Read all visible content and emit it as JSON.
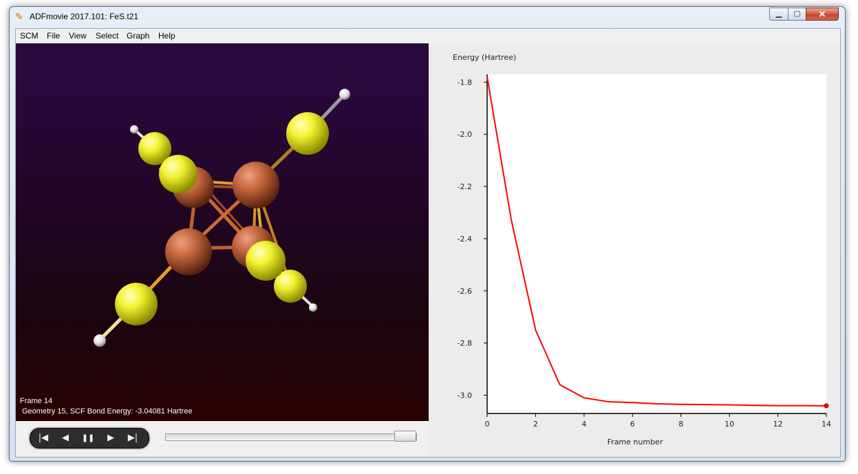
{
  "window": {
    "title": "ADFmovie 2017.101: FeS.t21",
    "app_icon": "adf-wand-icon",
    "minimize_glyph": "▁",
    "maximize_glyph": "▢",
    "close_glyph": "✕"
  },
  "menu": [
    "SCM",
    "File",
    "View",
    "Select",
    "Graph",
    "Help"
  ],
  "viewer": {
    "frame_label": "Frame 14",
    "energy_label": "Geometry 15, SCF Bond Energy: -3.04081 Hartree",
    "colors": {
      "iron": "#c0643a",
      "sulfur": "#e8e820",
      "hydrogen": "#ffffff",
      "background_top": "#2a0840",
      "background_bottom": "#280202"
    }
  },
  "player": {
    "buttons": [
      "first-frame",
      "previous-frame",
      "pause",
      "next-frame",
      "last-frame"
    ],
    "glyphs": [
      "|◀",
      "◀",
      "❚❚",
      "▶",
      "▶|"
    ],
    "position": 1.0
  },
  "chart_data": {
    "type": "line",
    "title": "",
    "ylabel": "Energy (Hartree)",
    "xlabel": "Frame number",
    "x": [
      0,
      1,
      2,
      3,
      4,
      5,
      6,
      7,
      8,
      9,
      10,
      11,
      12,
      13,
      14
    ],
    "series": [
      {
        "color": "#ff0000",
        "values": [
          -1.78,
          -2.33,
          -2.75,
          -2.96,
          -3.01,
          -3.025,
          -3.028,
          -3.033,
          -3.035,
          -3.036,
          -3.037,
          -3.039,
          -3.04,
          -3.04,
          -3.0408
        ]
      }
    ],
    "xlim": [
      0,
      14
    ],
    "ylim": [
      -3.07,
      -1.77
    ],
    "xticks": [
      0,
      2,
      4,
      6,
      8,
      10,
      12,
      14
    ],
    "yticks": [
      -1.8,
      -2.0,
      -2.2,
      -2.4,
      -2.6,
      -2.8,
      -3.0
    ],
    "ytick_labels": [
      "-1.8",
      "-2.0",
      "-2.2",
      "-2.4",
      "-2.6",
      "-2.8",
      "-3.0"
    ],
    "current_frame": 14,
    "grid": false
  }
}
